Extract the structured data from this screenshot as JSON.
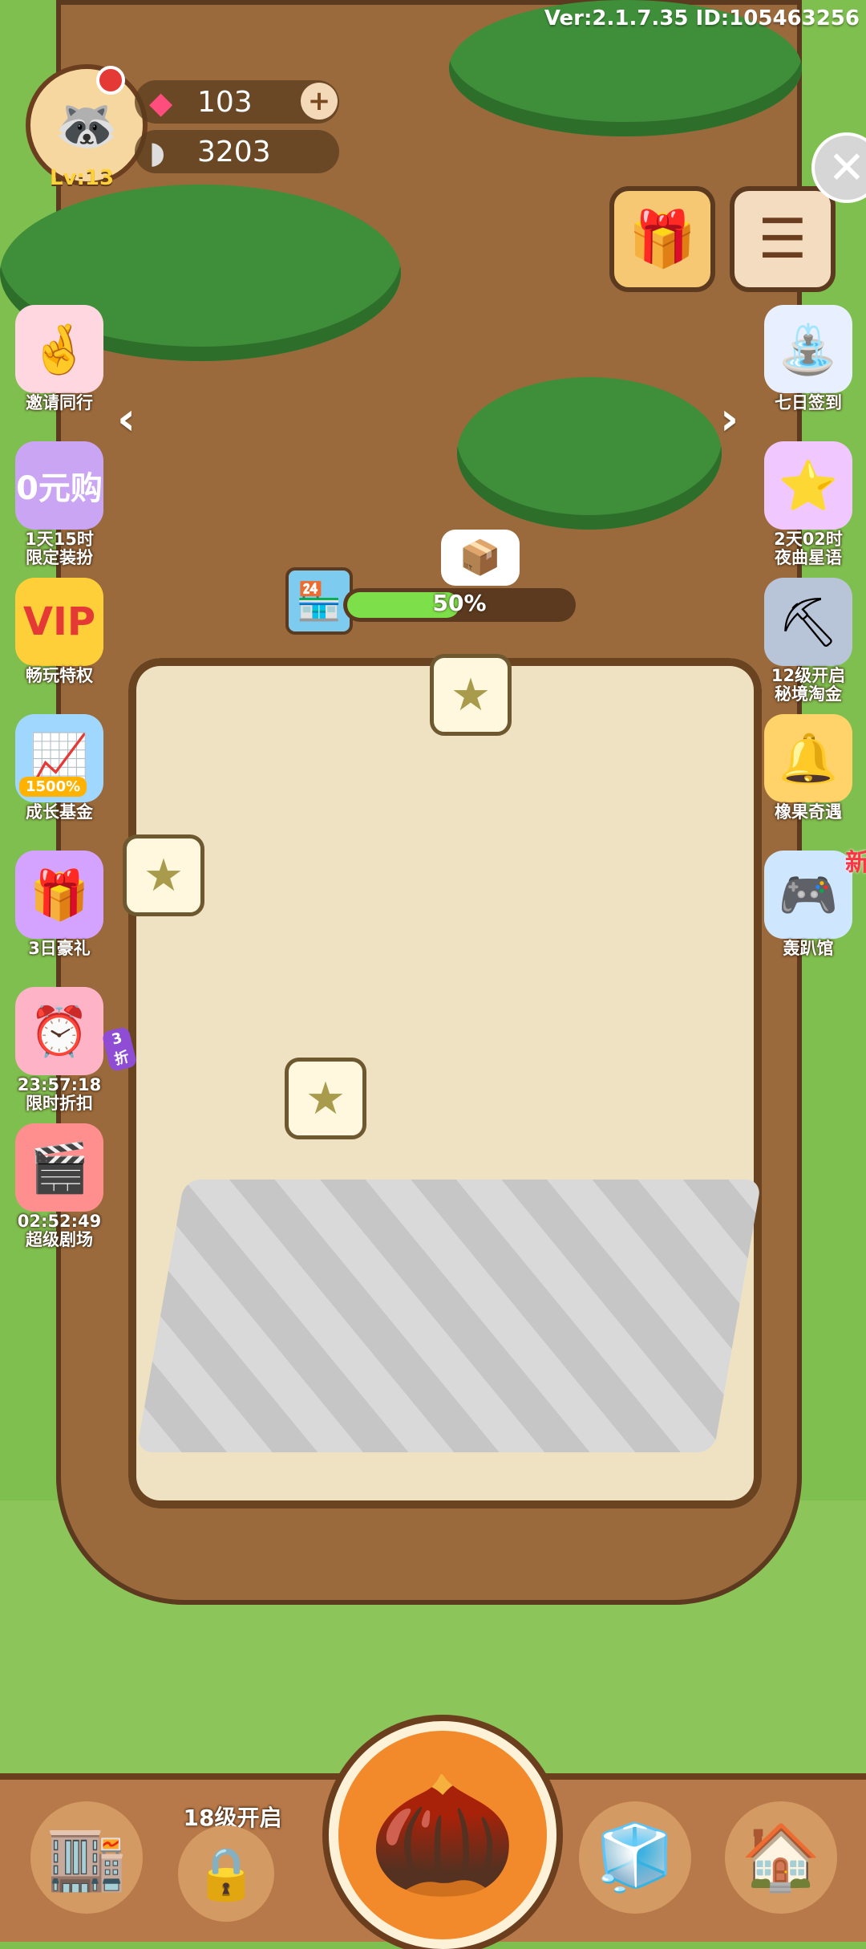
{
  "version_text": "Ver:2.1.7.35 ID:105463256",
  "player": {
    "level": "Lv:13",
    "gems": "103",
    "seeds": "3203"
  },
  "left_menu": [
    {
      "label": "邀请同行",
      "icon": "invite-hand-icon"
    },
    {
      "label": "1天15时",
      "sub": "限定装扮",
      "icon": "zero-yuan-buy-icon"
    },
    {
      "label": "畅玩特权",
      "icon": "vip-privilege-icon"
    },
    {
      "label": "成长基金",
      "icon": "growth-fund-icon",
      "badge": "1500%"
    },
    {
      "label": "3日豪礼",
      "icon": "gift-box-icon"
    },
    {
      "label": "23:57:18",
      "sub": "限时折扣",
      "icon": "alarm-clock-icon",
      "badge": "3折"
    },
    {
      "label": "02:52:49",
      "sub": "超级剧场",
      "icon": "theater-icon"
    }
  ],
  "right_menu": [
    {
      "label": "七日签到",
      "icon": "seven-day-signin-icon"
    },
    {
      "label": "2天02时",
      "sub": "夜曲星语",
      "icon": "star-net-icon"
    },
    {
      "label": "12级开启",
      "sub": "秘境淘金",
      "icon": "mine-cart-icon"
    },
    {
      "label": "橡果奇遇",
      "icon": "acorn-bell-icon"
    },
    {
      "label": "轰趴馆",
      "icon": "gamepad-icon",
      "new_label": "新"
    }
  ],
  "shop_progress": {
    "percent_text": "50%",
    "value": 0.5
  },
  "bottom_bar": {
    "locked_label": "18级开启"
  },
  "colors": {
    "progress_green": "#7de04a",
    "wood_dark": "#5b3a1f",
    "leaf_green": "#3f8f3a"
  }
}
